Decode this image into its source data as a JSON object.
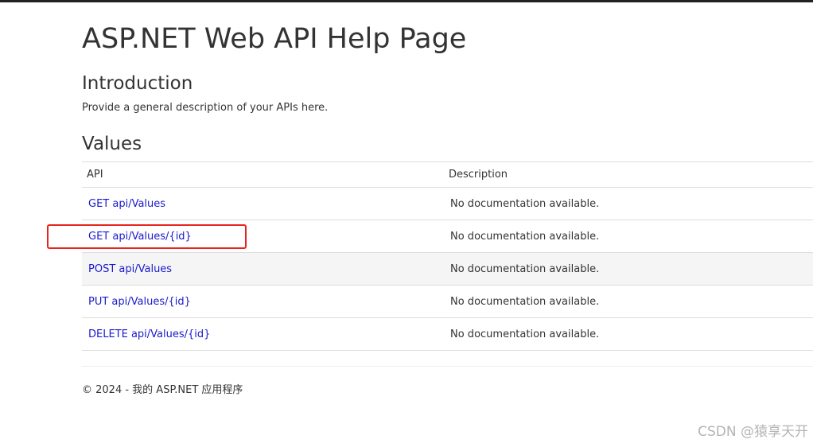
{
  "header": {
    "title": "ASP.NET Web API Help Page"
  },
  "introduction": {
    "heading": "Introduction",
    "text": "Provide a general description of your APIs here."
  },
  "values_section": {
    "heading": "Values",
    "columns": {
      "api": "API",
      "description": "Description"
    },
    "rows": [
      {
        "api": "GET api/Values",
        "description": "No documentation available."
      },
      {
        "api": "GET api/Values/{id}",
        "description": "No documentation available."
      },
      {
        "api": "POST api/Values",
        "description": "No documentation available."
      },
      {
        "api": "PUT api/Values/{id}",
        "description": "No documentation available."
      },
      {
        "api": "DELETE api/Values/{id}",
        "description": "No documentation available."
      }
    ]
  },
  "highlight": {
    "color": "#e8231f"
  },
  "footer": {
    "text": "© 2024 - 我的 ASP.NET 应用程序"
  },
  "watermark": {
    "text": "CSDN @猿享天开"
  },
  "colors": {
    "link": "#1a1acc",
    "text": "#333333",
    "alt_row": "#f5f5f5"
  }
}
